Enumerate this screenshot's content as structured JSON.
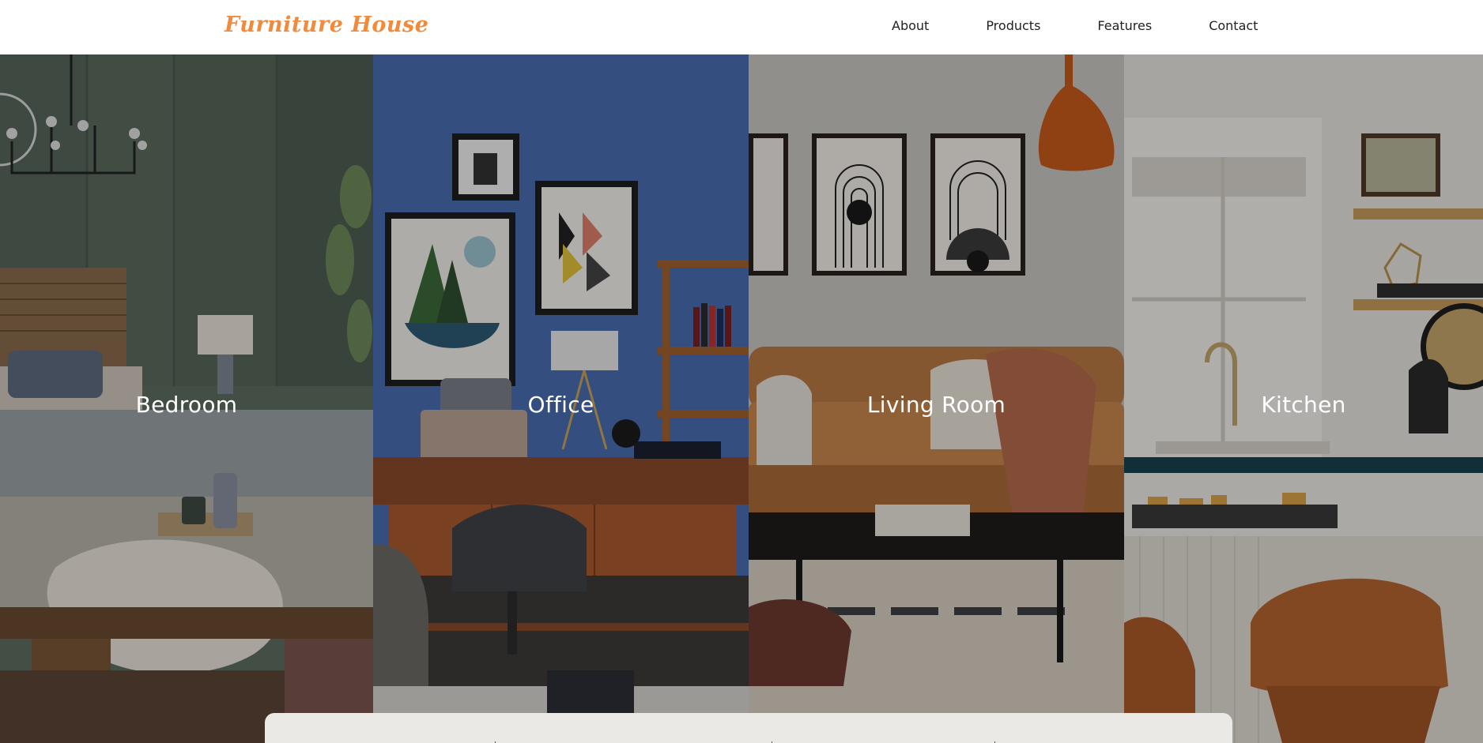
{
  "header": {
    "logo": "Furniture House",
    "nav": [
      {
        "label": "About"
      },
      {
        "label": "Products"
      },
      {
        "label": "Features"
      },
      {
        "label": "Contact"
      }
    ]
  },
  "panels": [
    {
      "label": "Bedroom"
    },
    {
      "label": "Office"
    },
    {
      "label": "Living Room"
    },
    {
      "label": "Kitchen"
    }
  ],
  "colors": {
    "brand": "#f08a3c",
    "nav_text": "#222222",
    "card_bg": "#ebe9e6"
  }
}
